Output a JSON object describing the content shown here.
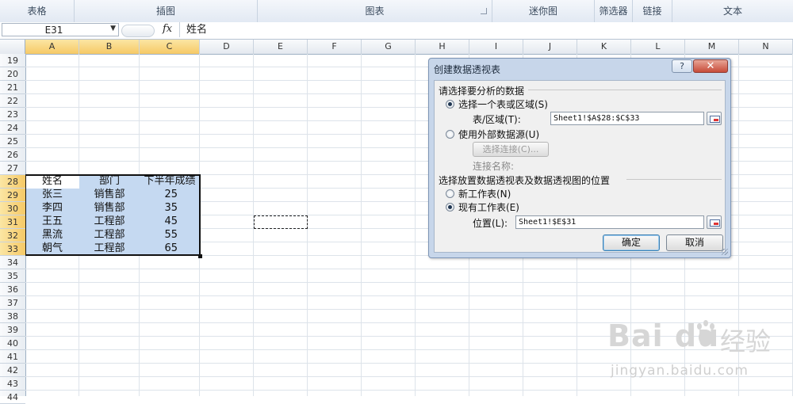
{
  "ribbon": {
    "groups": [
      {
        "label": "表格",
        "launcher": false
      },
      {
        "label": "插图",
        "launcher": false
      },
      {
        "label": "图表",
        "launcher": true
      },
      {
        "label": "迷你图",
        "launcher": false
      },
      {
        "label": "筛选器",
        "launcher": false
      },
      {
        "label": "链接",
        "launcher": false
      },
      {
        "label": "文本",
        "launcher": false
      }
    ]
  },
  "formula_bar": {
    "name_box": "E31",
    "fx": "fx",
    "content": "姓名"
  },
  "grid": {
    "columns": [
      "A",
      "B",
      "C",
      "D",
      "E",
      "F",
      "G",
      "H",
      "I",
      "J",
      "K",
      "L",
      "M",
      "N"
    ],
    "selected_columns": [
      "A",
      "B",
      "C"
    ],
    "rows": [
      "19",
      "20",
      "21",
      "22",
      "23",
      "24",
      "25",
      "26",
      "27",
      "28",
      "29",
      "30",
      "31",
      "32",
      "33",
      "34",
      "35",
      "36",
      "37",
      "38",
      "39",
      "40",
      "41",
      "42",
      "43",
      "44"
    ],
    "selected_rows": [
      "28",
      "29",
      "30",
      "31",
      "32",
      "33"
    ],
    "table": {
      "header": [
        "姓名",
        "部门",
        "下半年成绩"
      ],
      "rows": [
        [
          "张三",
          "销售部",
          "25"
        ],
        [
          "李四",
          "销售部",
          "35"
        ],
        [
          "王五",
          "工程部",
          "45"
        ],
        [
          "黑流",
          "工程部",
          "55"
        ],
        [
          "朝气",
          "工程部",
          "65"
        ]
      ]
    },
    "colors": {
      "selection_fill": "#c5d9f1",
      "header_highlight": "#f6c966"
    }
  },
  "dialog": {
    "title": "创建数据透视表",
    "help": "?",
    "close": "✕",
    "section1": "请选择要分析的数据",
    "radio_table": "选择一个表或区域(S)",
    "range_label": "表/区域(T):",
    "range_value": "Sheet1!$A$28:$C$33",
    "radio_external": "使用外部数据源(U)",
    "choose_conn_btn": "选择连接(C)...",
    "conn_name_label": "连接名称:",
    "section2": "选择放置数据透视表及数据透视图的位置",
    "radio_new_sheet": "新工作表(N)",
    "radio_existing": "现有工作表(E)",
    "location_label": "位置(L):",
    "location_value": "Sheet1!$E$31",
    "ok": "确定",
    "cancel": "取消"
  },
  "watermark": {
    "brand": "Bai du",
    "suffix": "经验",
    "url": "jingyan.baidu.com"
  }
}
